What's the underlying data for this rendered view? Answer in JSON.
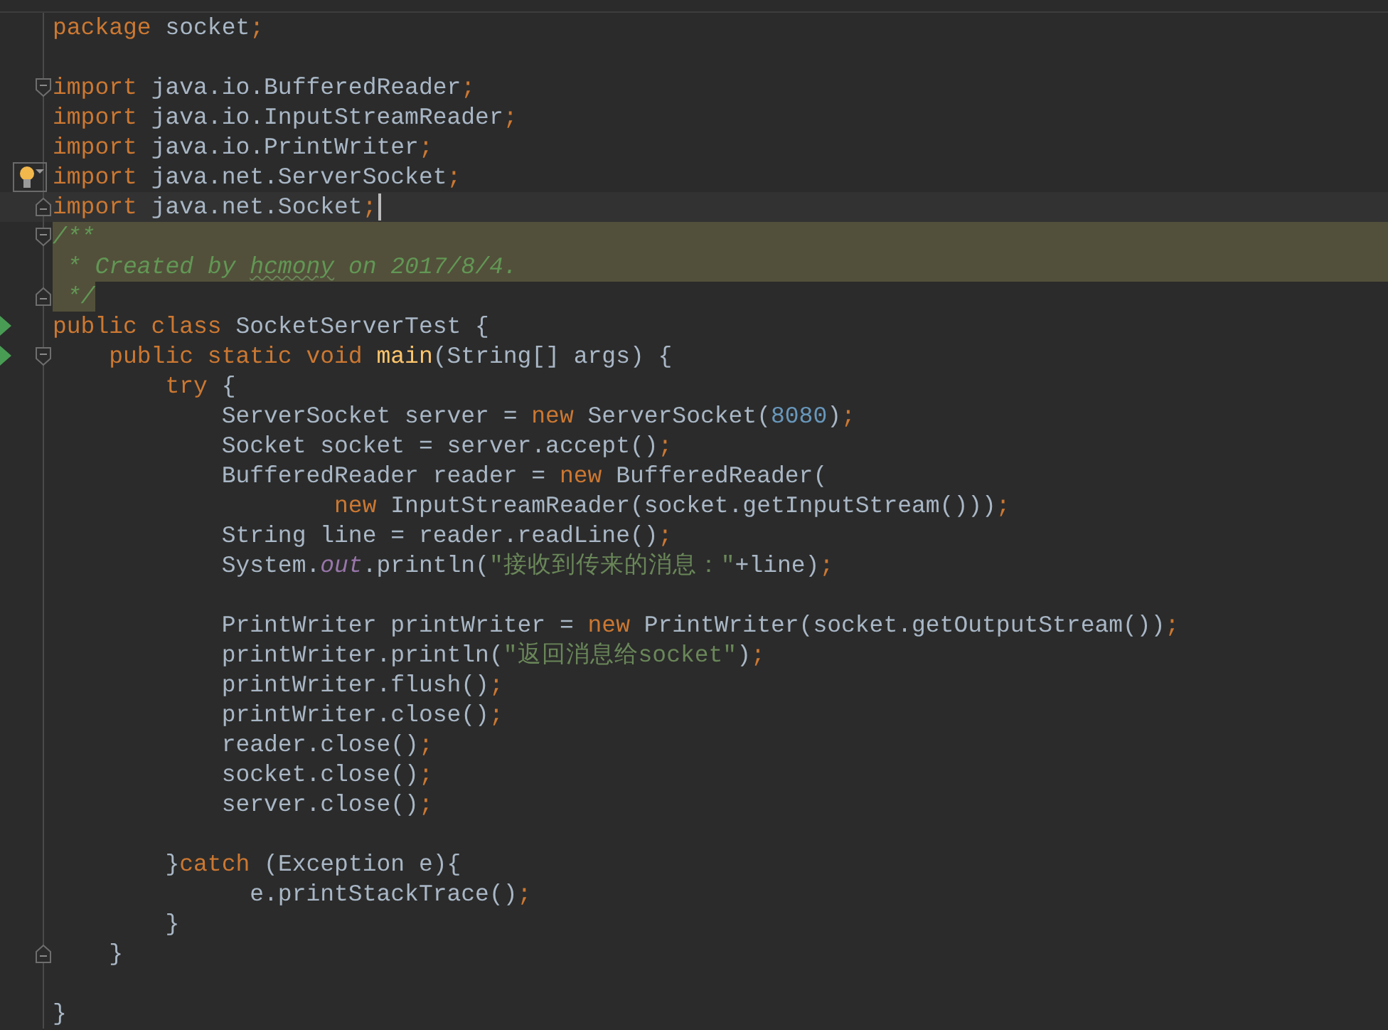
{
  "editor": {
    "lines": [
      {
        "highlighted": false,
        "tokens": [
          {
            "text": "package ",
            "kind": "keyword"
          },
          {
            "text": "socket",
            "kind": "plain"
          },
          {
            "text": ";",
            "kind": "punct"
          }
        ]
      },
      {
        "highlighted": false
      },
      {
        "highlighted": false,
        "gutter": [
          {
            "kind": "fold-open"
          }
        ],
        "tokens": [
          {
            "text": "import ",
            "kind": "keyword"
          },
          {
            "text": "java.io.BufferedReader",
            "kind": "plain"
          },
          {
            "text": ";",
            "kind": "punct"
          }
        ]
      },
      {
        "highlighted": false,
        "tokens": [
          {
            "text": "import ",
            "kind": "keyword"
          },
          {
            "text": "java.io.InputStreamReader",
            "kind": "plain"
          },
          {
            "text": ";",
            "kind": "punct"
          }
        ]
      },
      {
        "highlighted": false,
        "tokens": [
          {
            "text": "import ",
            "kind": "keyword"
          },
          {
            "text": "java.io.PrintWriter",
            "kind": "plain"
          },
          {
            "text": ";",
            "kind": "punct"
          }
        ]
      },
      {
        "highlighted": false,
        "gutter": [
          {
            "kind": "bulb"
          }
        ],
        "tokens": [
          {
            "text": "import ",
            "kind": "keyword"
          },
          {
            "text": "java.net.ServerSocket",
            "kind": "plain"
          },
          {
            "text": ";",
            "kind": "punct"
          }
        ]
      },
      {
        "highlighted": false,
        "gutter": [
          {
            "kind": "fold-close"
          }
        ],
        "cursor": {
          "kind": "caret"
        },
        "tokens": [
          {
            "text": "import ",
            "kind": "keyword"
          },
          {
            "text": "java.net.Socket",
            "kind": "plain"
          },
          {
            "text": ";",
            "kind": "punct"
          }
        ]
      },
      {
        "highlighted": true,
        "gutter": [
          {
            "kind": "fold-open"
          }
        ],
        "tokens": [
          {
            "text": "/**",
            "kind": "comment"
          }
        ]
      },
      {
        "highlighted": true,
        "tokens": [
          {
            "text": " * Created by ",
            "kind": "comment"
          },
          {
            "text": "hcmony",
            "kind": "comment-typo"
          },
          {
            "text": " on 2017/8/4.",
            "kind": "comment"
          }
        ]
      },
      {
        "highlighted": true,
        "gutter": [
          {
            "kind": "fold-close"
          }
        ],
        "tokens": [
          {
            "text": " */",
            "kind": "comment"
          }
        ]
      },
      {
        "highlighted": false,
        "gutter": [
          {
            "kind": "run"
          }
        ],
        "tokens": [
          {
            "text": "public class ",
            "kind": "keyword"
          },
          {
            "text": "SocketServerTest {",
            "kind": "plain"
          }
        ]
      },
      {
        "highlighted": false,
        "gutter": [
          {
            "kind": "run"
          },
          {
            "kind": "fold-open"
          }
        ],
        "tokens": [
          {
            "text": "    public static void ",
            "kind": "keyword"
          },
          {
            "text": "main",
            "kind": "method"
          },
          {
            "text": "(String[] args) {",
            "kind": "plain"
          }
        ]
      },
      {
        "highlighted": false,
        "tokens": [
          {
            "text": "        try ",
            "kind": "keyword"
          },
          {
            "text": "{",
            "kind": "plain"
          }
        ]
      },
      {
        "highlighted": false,
        "tokens": [
          {
            "text": "            ServerSocket server = ",
            "kind": "plain"
          },
          {
            "text": "new ",
            "kind": "keyword"
          },
          {
            "text": "ServerSocket(",
            "kind": "plain"
          },
          {
            "text": "8080",
            "kind": "number"
          },
          {
            "text": ")",
            "kind": "plain"
          },
          {
            "text": ";",
            "kind": "punct"
          }
        ]
      },
      {
        "highlighted": false,
        "tokens": [
          {
            "text": "            Socket socket = server.accept()",
            "kind": "plain"
          },
          {
            "text": ";",
            "kind": "punct"
          }
        ]
      },
      {
        "highlighted": false,
        "tokens": [
          {
            "text": "            BufferedReader reader = ",
            "kind": "plain"
          },
          {
            "text": "new ",
            "kind": "keyword"
          },
          {
            "text": "BufferedReader(",
            "kind": "plain"
          }
        ]
      },
      {
        "highlighted": false,
        "tokens": [
          {
            "text": "                    new ",
            "kind": "keyword"
          },
          {
            "text": "InputStreamReader(socket.getInputStream()))",
            "kind": "plain"
          },
          {
            "text": ";",
            "kind": "punct"
          }
        ]
      },
      {
        "highlighted": false,
        "tokens": [
          {
            "text": "            String line = reader.readLine()",
            "kind": "plain"
          },
          {
            "text": ";",
            "kind": "punct"
          }
        ]
      },
      {
        "highlighted": false,
        "tokens": [
          {
            "text": "            System.",
            "kind": "plain"
          },
          {
            "text": "out",
            "kind": "field"
          },
          {
            "text": ".println(",
            "kind": "plain"
          },
          {
            "text": "\"接收到传来的消息：\"",
            "kind": "string"
          },
          {
            "text": "+line)",
            "kind": "plain"
          },
          {
            "text": ";",
            "kind": "punct"
          }
        ]
      },
      {
        "highlighted": false
      },
      {
        "highlighted": false,
        "tokens": [
          {
            "text": "            PrintWriter printWriter = ",
            "kind": "plain"
          },
          {
            "text": "new ",
            "kind": "keyword"
          },
          {
            "text": "PrintWriter(socket.getOutputStream())",
            "kind": "plain"
          },
          {
            "text": ";",
            "kind": "punct"
          }
        ]
      },
      {
        "highlighted": false,
        "tokens": [
          {
            "text": "            printWriter.println(",
            "kind": "plain"
          },
          {
            "text": "\"返回消息给socket\"",
            "kind": "string"
          },
          {
            "text": ")",
            "kind": "plain"
          },
          {
            "text": ";",
            "kind": "punct"
          }
        ]
      },
      {
        "highlighted": false,
        "tokens": [
          {
            "text": "            printWriter.flush()",
            "kind": "plain"
          },
          {
            "text": ";",
            "kind": "punct"
          }
        ]
      },
      {
        "highlighted": false,
        "tokens": [
          {
            "text": "            printWriter.close()",
            "kind": "plain"
          },
          {
            "text": ";",
            "kind": "punct"
          }
        ]
      },
      {
        "highlighted": false,
        "tokens": [
          {
            "text": "            reader.close()",
            "kind": "plain"
          },
          {
            "text": ";",
            "kind": "punct"
          }
        ]
      },
      {
        "highlighted": false,
        "tokens": [
          {
            "text": "            socket.close()",
            "kind": "plain"
          },
          {
            "text": ";",
            "kind": "punct"
          }
        ]
      },
      {
        "highlighted": false,
        "tokens": [
          {
            "text": "            server.close()",
            "kind": "plain"
          },
          {
            "text": ";",
            "kind": "punct"
          }
        ]
      },
      {
        "highlighted": false
      },
      {
        "highlighted": false,
        "tokens": [
          {
            "text": "        }",
            "kind": "plain"
          },
          {
            "text": "catch ",
            "kind": "keyword"
          },
          {
            "text": "(Exception e){",
            "kind": "plain"
          }
        ]
      },
      {
        "highlighted": false,
        "tokens": [
          {
            "text": "              e.printStackTrace()",
            "kind": "plain"
          },
          {
            "text": ";",
            "kind": "punct"
          }
        ]
      },
      {
        "highlighted": false,
        "tokens": [
          {
            "text": "        }",
            "kind": "plain"
          }
        ]
      },
      {
        "highlighted": false,
        "gutter": [
          {
            "kind": "fold-close"
          }
        ],
        "tokens": [
          {
            "text": "    }",
            "kind": "plain"
          }
        ]
      },
      {
        "highlighted": false
      },
      {
        "highlighted": false,
        "tokens": [
          {
            "text": "}",
            "kind": "plain"
          }
        ]
      }
    ]
  }
}
